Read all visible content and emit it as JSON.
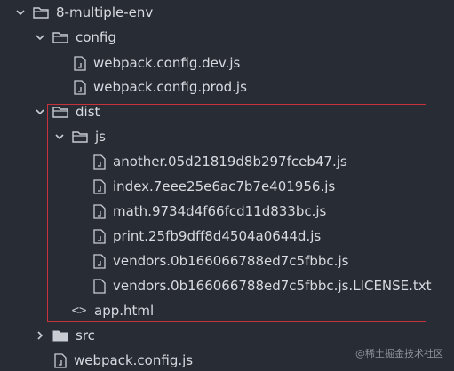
{
  "tree": {
    "root": {
      "label": "8-multiple-env",
      "expanded": true
    },
    "config": {
      "label": "config",
      "files": [
        "webpack.config.dev.js",
        "webpack.config.prod.js"
      ]
    },
    "dist": {
      "label": "dist",
      "js_folder": {
        "label": "js",
        "files": [
          "another.05d21819d8b297fceb47.js",
          "index.7eee25e6ac7b7e401956.js",
          "math.9734d4f66fcd11d833bc.js",
          "print.25fb9dff8d4504a0644d.js",
          "vendors.0b166066788ed7c5fbbc.js",
          "vendors.0b166066788ed7c5fbbc.js.LICENSE.txt"
        ]
      },
      "html_file": "app.html"
    },
    "src": {
      "label": "src",
      "expanded": false
    },
    "root_file": "webpack.config.js"
  },
  "watermark": "@稀土掘金技术社区",
  "colors": {
    "background": "#282c34",
    "text": "#d7dae0",
    "highlight_border": "#c8323a",
    "icon": "#c9ccd3"
  },
  "icons": {
    "expanded": "chevron-down-icon",
    "collapsed": "chevron-right-icon",
    "folder": "folder-icon",
    "file": "file-icon",
    "html": "code-icon"
  }
}
